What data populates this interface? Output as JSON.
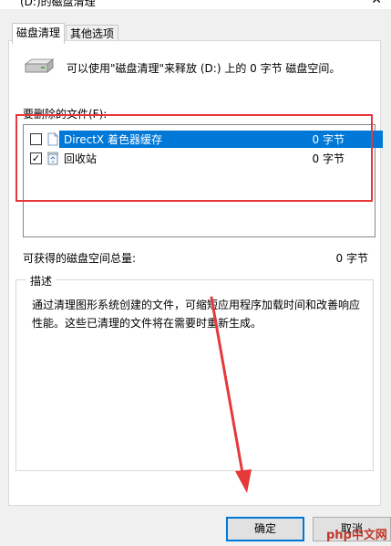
{
  "window": {
    "title": "(D:)的磁盘清理"
  },
  "tabs": [
    {
      "label": "磁盘清理"
    },
    {
      "label": "其他选项"
    }
  ],
  "info": {
    "text": "可以使用\"磁盘清理\"来释放 (D:) 上的 0 字节 磁盘空间。"
  },
  "files_section": {
    "label": "要删除的文件(F):"
  },
  "files": [
    {
      "name": "DirectX 着色器缓存",
      "size": "0 字节",
      "checked": false,
      "icon": "file-icon"
    },
    {
      "name": "回收站",
      "size": "0 字节",
      "checked": true,
      "icon": "recycle-bin-icon"
    }
  ],
  "total": {
    "label": "可获得的磁盘空间总量:",
    "value": "0 字节"
  },
  "description": {
    "legend": "描述",
    "text": "通过清理图形系统创建的文件，可缩短应用程序加载时间和改善响应性能。这些已清理的文件将在需要时重新生成。"
  },
  "buttons": {
    "ok": "确定",
    "cancel": "取消"
  },
  "watermark": "php中文网",
  "colors": {
    "accent": "#0078d7",
    "highlight_box": "#e5383b"
  }
}
